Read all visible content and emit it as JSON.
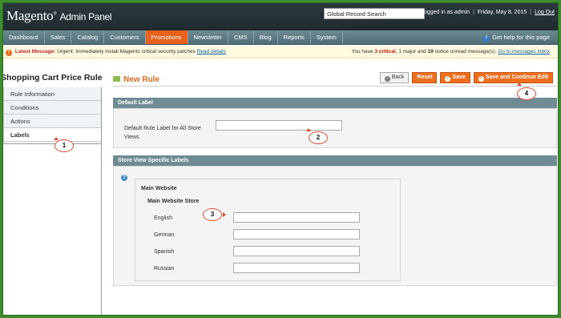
{
  "header": {
    "logo_main": "Magento",
    "logo_sub": "Admin Panel",
    "search_value": "Global Record Search",
    "logged_in": "Logged in as admin",
    "date": "Friday, May 8, 2015",
    "logout": "Log Out"
  },
  "nav": {
    "items": [
      "Dashboard",
      "Sales",
      "Catalog",
      "Customers",
      "Promotions",
      "Newsletter",
      "CMS",
      "Blog",
      "Reports",
      "System"
    ],
    "active": "Promotions",
    "help": "Get help for this page"
  },
  "message": {
    "label": "Latest Message:",
    "text": "Urgent: Immediately install Magento critical security patches",
    "link": "Read details",
    "summary_pre": "You have",
    "critical_count": "3",
    "critical_label": "critical",
    "major_text": ", 1 major and",
    "notice_count": "19",
    "notice_text": "notice unread message(s).",
    "goto_link": "Go to messages inbox"
  },
  "sidebar": {
    "title": "Shopping Cart Price Rule",
    "tabs": [
      "Rule Information",
      "Conditions",
      "Actions",
      "Labels"
    ],
    "active": "Labels"
  },
  "content": {
    "title": "New Rule",
    "buttons": {
      "back": "Back",
      "reset": "Reset",
      "save": "Save",
      "save_continue": "Save and Continue Edit"
    },
    "default_label": {
      "heading": "Default Label",
      "field_label": "Default Rule Label for All Store Views",
      "value": ""
    },
    "store_labels": {
      "heading": "Store View Specific Labels",
      "website": "Main Website",
      "store": "Main Website Store",
      "languages": [
        {
          "name": "English",
          "value": ""
        },
        {
          "name": "German",
          "value": ""
        },
        {
          "name": "Spanish",
          "value": ""
        },
        {
          "name": "Russian",
          "value": ""
        }
      ]
    }
  },
  "callouts": [
    "1",
    "2",
    "3",
    "4"
  ],
  "colors": {
    "accent": "#e9621d",
    "header_bg": "#2b3a3f",
    "nav_bg": "#5c7b83",
    "section_head": "#6f8b94",
    "callout_border": "#e04a2f"
  }
}
